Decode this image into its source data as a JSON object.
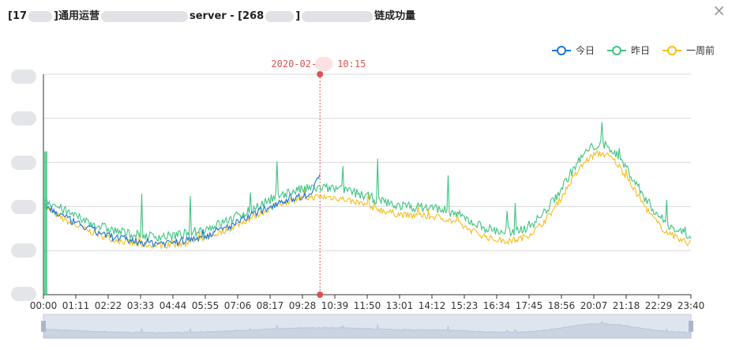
{
  "window": {
    "title_parts": [
      "[17",
      "]通用运营",
      "server - [268",
      "]",
      "链成功量"
    ],
    "close_glyph": "×"
  },
  "chart_data": {
    "type": "line",
    "series": [
      {
        "name": "今日",
        "color": "#1a76d6"
      },
      {
        "name": "昨日",
        "color": "#3ec481"
      },
      {
        "name": "一周前",
        "color": "#f5be1b"
      }
    ],
    "x_ticks": [
      "00:00",
      "01:11",
      "02:22",
      "03:33",
      "04:44",
      "05:55",
      "07:06",
      "08:17",
      "09:28",
      "10:39",
      "11:50",
      "13:01",
      "14:12",
      "15:23",
      "16:34",
      "17:45",
      "18:56",
      "20:07",
      "21:18",
      "22:29",
      "23:40"
    ],
    "y_range": [
      0,
      5
    ],
    "marker_label": "2020-02-",
    "marker_time_text": "10:15",
    "marker_x_minutes": 615,
    "grid": true,
    "legend_position": "top-right",
    "data_zoom": true
  }
}
